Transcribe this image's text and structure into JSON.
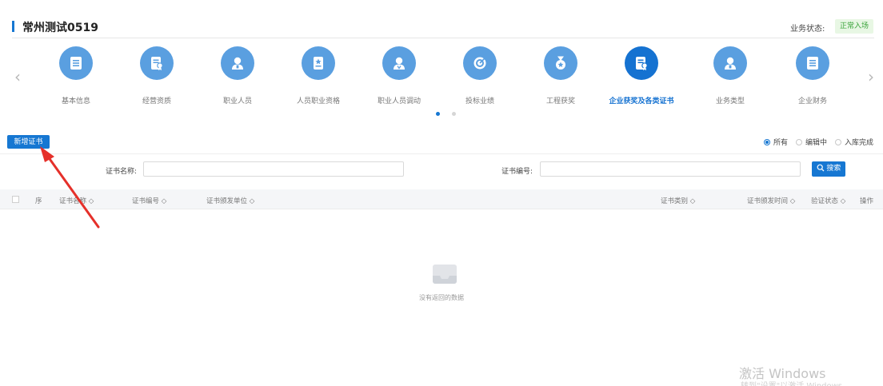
{
  "header": {
    "title": "常州测试0519",
    "status_label": "业务状态:",
    "status_value": "正常入场"
  },
  "categories": [
    {
      "label": "基本信息",
      "icon": "list-doc-icon",
      "active": false
    },
    {
      "label": "经营资质",
      "icon": "certificate-doc-icon",
      "active": false
    },
    {
      "label": "职业人员",
      "icon": "person-icon",
      "active": false
    },
    {
      "label": "人员职业资格",
      "icon": "star-doc-icon",
      "active": false
    },
    {
      "label": "职业人员调动",
      "icon": "person-transfer-icon",
      "active": false
    },
    {
      "label": "投标业绩",
      "icon": "target-icon",
      "active": false
    },
    {
      "label": "工程获奖",
      "icon": "medal-icon",
      "active": false
    },
    {
      "label": "企业获奖及各类证书",
      "icon": "certificate-doc-icon",
      "active": true
    },
    {
      "label": "业务类型",
      "icon": "person-icon",
      "active": false
    },
    {
      "label": "企业财务",
      "icon": "list-doc-icon",
      "active": false
    }
  ],
  "carousel": {
    "page_count": 2,
    "current_page": 1
  },
  "toolbar": {
    "add_button": "新增证书",
    "filters": [
      {
        "label": "所有",
        "selected": true
      },
      {
        "label": "编辑中",
        "selected": false
      },
      {
        "label": "入库完成",
        "selected": false
      }
    ]
  },
  "search": {
    "name_label": "证书名称:",
    "name_value": "",
    "number_label": "证书编号:",
    "number_value": "",
    "button": "搜索"
  },
  "table": {
    "columns": [
      "序",
      "证书名称 ◇",
      "证书编号 ◇",
      "证书颁发单位 ◇",
      "证书类别 ◇",
      "证书颁发时间 ◇",
      "验证状态 ◇",
      "操作"
    ],
    "rows": [],
    "empty_text": "没有返回的数据"
  },
  "watermark": {
    "line1": "激活 Windows",
    "line2": "转到\"设置\"以激活 Windows"
  },
  "colors": {
    "primary": "#1677d2",
    "icon_bg": "#5a9fe0",
    "status_text": "#3aa33a",
    "annotation": "#e5302a"
  }
}
